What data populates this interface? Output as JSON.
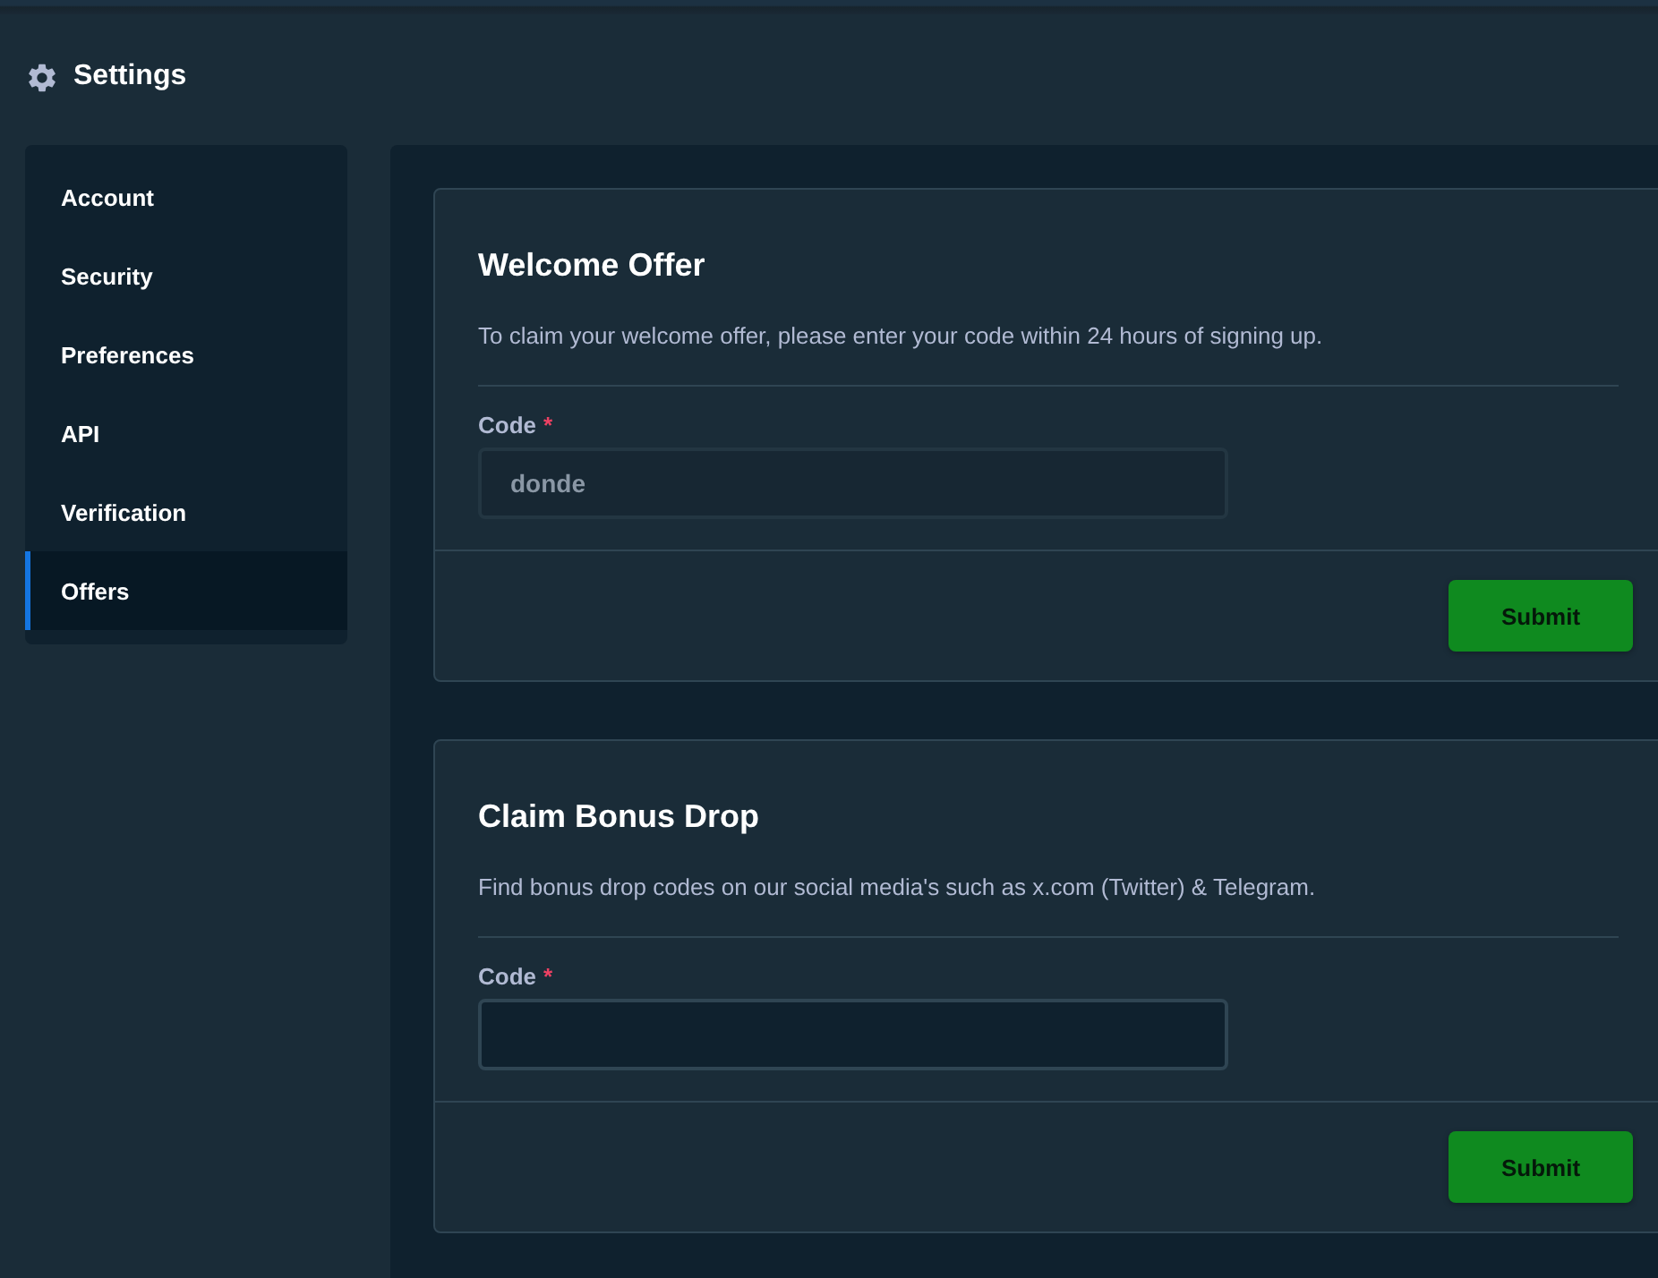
{
  "header": {
    "title": "Settings"
  },
  "sidebar": {
    "items": [
      {
        "label": "Account",
        "selected": false
      },
      {
        "label": "Security",
        "selected": false
      },
      {
        "label": "Preferences",
        "selected": false
      },
      {
        "label": "API",
        "selected": false
      },
      {
        "label": "Verification",
        "selected": false
      },
      {
        "label": "Offers",
        "selected": true
      }
    ]
  },
  "cards": [
    {
      "title": "Welcome Offer",
      "description": "To claim your welcome offer, please enter your code within 24 hours of signing up.",
      "field": {
        "label": "Code",
        "required_mark": "*",
        "value": "donde",
        "disabled": true
      },
      "button": "Submit"
    },
    {
      "title": "Claim Bonus Drop",
      "description": "Find bonus drop codes on our social media's such as x.com (Twitter) & Telegram.",
      "field": {
        "label": "Code",
        "required_mark": "*",
        "disabled": false
      },
      "button": "Submit"
    }
  ]
}
